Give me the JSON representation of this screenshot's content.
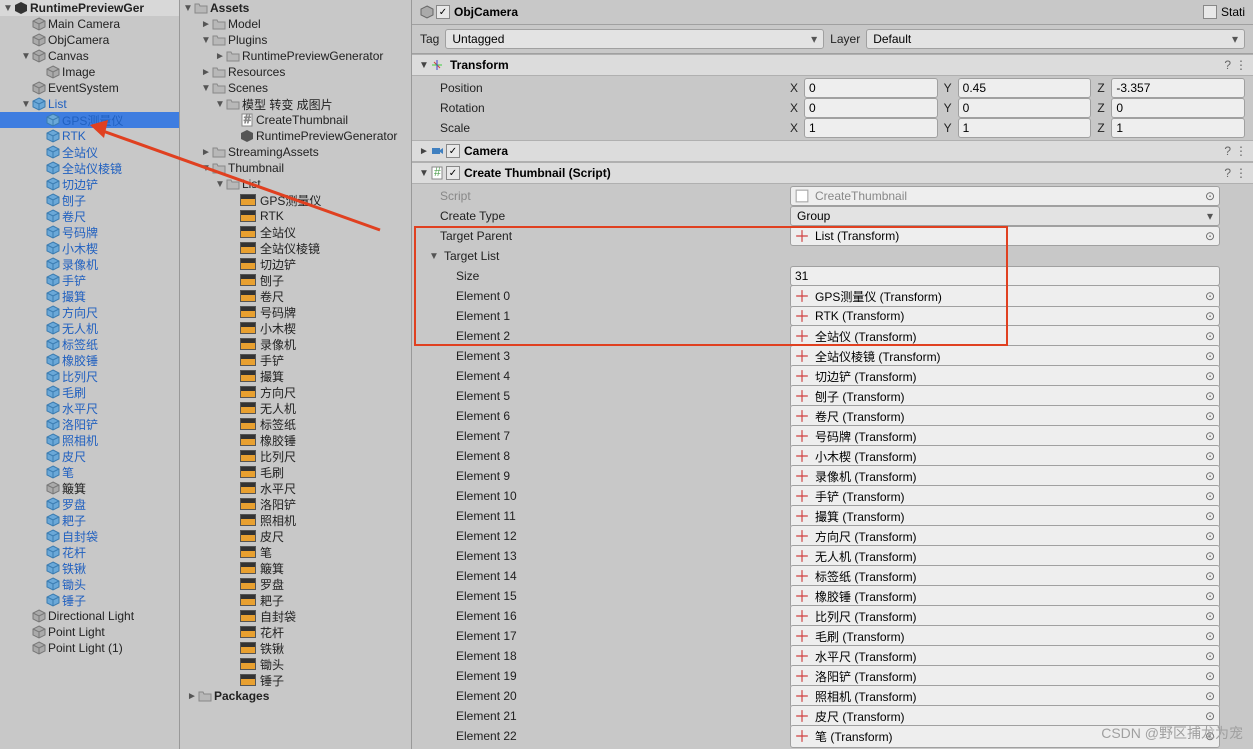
{
  "hierarchy": {
    "root": "RuntimePreviewGer",
    "items": [
      {
        "d": 1,
        "i": "cube-gray",
        "t": "Main Camera"
      },
      {
        "d": 1,
        "i": "cube-gray",
        "t": "ObjCamera"
      },
      {
        "d": 1,
        "i": "cube-gray",
        "t": "Canvas",
        "f": "open"
      },
      {
        "d": 2,
        "i": "cube-gray",
        "t": "Image"
      },
      {
        "d": 1,
        "i": "cube-gray",
        "t": "EventSystem"
      },
      {
        "d": 1,
        "i": "cube-blue",
        "t": "List",
        "f": "open",
        "blue": true
      },
      {
        "d": 2,
        "i": "cube-blue",
        "t": "GPS测量仪",
        "blue": true,
        "sel": true
      },
      {
        "d": 2,
        "i": "cube-blue",
        "t": "RTK",
        "blue": true
      },
      {
        "d": 2,
        "i": "cube-blue",
        "t": "全站仪",
        "blue": true
      },
      {
        "d": 2,
        "i": "cube-blue",
        "t": "全站仪棱镜",
        "blue": true
      },
      {
        "d": 2,
        "i": "cube-blue",
        "t": "切边铲",
        "blue": true
      },
      {
        "d": 2,
        "i": "cube-blue",
        "t": "刨子",
        "blue": true
      },
      {
        "d": 2,
        "i": "cube-blue",
        "t": "卷尺",
        "blue": true
      },
      {
        "d": 2,
        "i": "cube-blue",
        "t": "号码牌",
        "blue": true
      },
      {
        "d": 2,
        "i": "cube-blue",
        "t": "小木楔",
        "blue": true
      },
      {
        "d": 2,
        "i": "cube-blue",
        "t": "录像机",
        "blue": true
      },
      {
        "d": 2,
        "i": "cube-blue",
        "t": "手铲",
        "blue": true
      },
      {
        "d": 2,
        "i": "cube-blue",
        "t": "撮箕",
        "blue": true
      },
      {
        "d": 2,
        "i": "cube-blue",
        "t": "方向尺",
        "blue": true
      },
      {
        "d": 2,
        "i": "cube-blue",
        "t": "无人机",
        "blue": true
      },
      {
        "d": 2,
        "i": "cube-blue",
        "t": "标签纸",
        "blue": true
      },
      {
        "d": 2,
        "i": "cube-blue",
        "t": "橡胶锤",
        "blue": true
      },
      {
        "d": 2,
        "i": "cube-blue",
        "t": "比列尺",
        "blue": true
      },
      {
        "d": 2,
        "i": "cube-blue",
        "t": "毛刷",
        "blue": true
      },
      {
        "d": 2,
        "i": "cube-blue",
        "t": "水平尺",
        "blue": true
      },
      {
        "d": 2,
        "i": "cube-blue",
        "t": "洛阳铲",
        "blue": true
      },
      {
        "d": 2,
        "i": "cube-blue",
        "t": "照相机",
        "blue": true
      },
      {
        "d": 2,
        "i": "cube-blue",
        "t": "皮尺",
        "blue": true
      },
      {
        "d": 2,
        "i": "cube-blue",
        "t": "笔",
        "blue": true
      },
      {
        "d": 2,
        "i": "cube-gray",
        "t": "簸箕"
      },
      {
        "d": 2,
        "i": "cube-blue",
        "t": "罗盘",
        "blue": true
      },
      {
        "d": 2,
        "i": "cube-blue",
        "t": "耙子",
        "blue": true
      },
      {
        "d": 2,
        "i": "cube-blue",
        "t": "自封袋",
        "blue": true
      },
      {
        "d": 2,
        "i": "cube-blue",
        "t": "花杆",
        "blue": true
      },
      {
        "d": 2,
        "i": "cube-blue",
        "t": "铁锹",
        "blue": true
      },
      {
        "d": 2,
        "i": "cube-blue",
        "t": "锄头",
        "blue": true
      },
      {
        "d": 2,
        "i": "cube-blue",
        "t": "锤子",
        "blue": true
      },
      {
        "d": 1,
        "i": "cube-gray",
        "t": "Directional Light"
      },
      {
        "d": 1,
        "i": "cube-gray",
        "t": "Point Light"
      },
      {
        "d": 1,
        "i": "cube-gray",
        "t": "Point Light (1)"
      }
    ]
  },
  "project": {
    "root": "Assets",
    "items": [
      {
        "d": 1,
        "i": "folder",
        "t": "Model",
        "f": "closed"
      },
      {
        "d": 1,
        "i": "folder",
        "t": "Plugins",
        "f": "open"
      },
      {
        "d": 2,
        "i": "folder",
        "t": "RuntimePreviewGenerator",
        "f": "closed"
      },
      {
        "d": 1,
        "i": "folder",
        "t": "Resources",
        "f": "closed"
      },
      {
        "d": 1,
        "i": "folder",
        "t": "Scenes",
        "f": "open"
      },
      {
        "d": 2,
        "i": "folder",
        "t": "模型 转变 成图片",
        "f": "open"
      },
      {
        "d": 3,
        "i": "cs",
        "t": "CreateThumbnail"
      },
      {
        "d": 3,
        "i": "scene",
        "t": "RuntimePreviewGenerator"
      },
      {
        "d": 1,
        "i": "folder",
        "t": "StreamingAssets",
        "f": "closed"
      },
      {
        "d": 1,
        "i": "folder",
        "t": "Thumbnail",
        "f": "open"
      },
      {
        "d": 2,
        "i": "folder",
        "t": "List",
        "f": "open"
      },
      {
        "d": 3,
        "i": "asset",
        "t": "GPS测量仪"
      },
      {
        "d": 3,
        "i": "asset",
        "t": "RTK"
      },
      {
        "d": 3,
        "i": "asset",
        "t": "全站仪"
      },
      {
        "d": 3,
        "i": "asset",
        "t": "全站仪棱镜"
      },
      {
        "d": 3,
        "i": "asset",
        "t": "切边铲"
      },
      {
        "d": 3,
        "i": "asset",
        "t": "刨子"
      },
      {
        "d": 3,
        "i": "asset",
        "t": "卷尺"
      },
      {
        "d": 3,
        "i": "asset",
        "t": "号码牌"
      },
      {
        "d": 3,
        "i": "asset",
        "t": "小木楔"
      },
      {
        "d": 3,
        "i": "asset",
        "t": "录像机"
      },
      {
        "d": 3,
        "i": "asset",
        "t": "手铲"
      },
      {
        "d": 3,
        "i": "asset",
        "t": "撮箕"
      },
      {
        "d": 3,
        "i": "asset",
        "t": "方向尺"
      },
      {
        "d": 3,
        "i": "asset",
        "t": "无人机"
      },
      {
        "d": 3,
        "i": "asset",
        "t": "标签纸"
      },
      {
        "d": 3,
        "i": "asset",
        "t": "橡胶锤"
      },
      {
        "d": 3,
        "i": "asset",
        "t": "比列尺"
      },
      {
        "d": 3,
        "i": "asset",
        "t": "毛刷"
      },
      {
        "d": 3,
        "i": "asset",
        "t": "水平尺"
      },
      {
        "d": 3,
        "i": "asset",
        "t": "洛阳铲"
      },
      {
        "d": 3,
        "i": "asset",
        "t": "照相机"
      },
      {
        "d": 3,
        "i": "asset",
        "t": "皮尺"
      },
      {
        "d": 3,
        "i": "asset",
        "t": "笔"
      },
      {
        "d": 3,
        "i": "asset",
        "t": "簸箕"
      },
      {
        "d": 3,
        "i": "asset",
        "t": "罗盘"
      },
      {
        "d": 3,
        "i": "asset",
        "t": "耙子"
      },
      {
        "d": 3,
        "i": "asset",
        "t": "自封袋"
      },
      {
        "d": 3,
        "i": "asset",
        "t": "花杆"
      },
      {
        "d": 3,
        "i": "asset",
        "t": "铁锹"
      },
      {
        "d": 3,
        "i": "asset",
        "t": "锄头"
      },
      {
        "d": 3,
        "i": "asset",
        "t": "锤子"
      },
      {
        "d": 0,
        "i": "folder",
        "t": "Packages",
        "f": "closed",
        "bold": true
      }
    ]
  },
  "inspector": {
    "obj_name": "ObjCamera",
    "static_lbl": "Stati",
    "tag_lbl": "Tag",
    "tag_val": "Untagged",
    "layer_lbl": "Layer",
    "layer_val": "Default",
    "transform": {
      "title": "Transform",
      "position_lbl": "Position",
      "px": "0",
      "py": "0.45",
      "pz": "-3.357",
      "rotation_lbl": "Rotation",
      "rx": "0",
      "ry": "0",
      "rz": "0",
      "scale_lbl": "Scale",
      "sx": "1",
      "sy": "1",
      "sz": "1",
      "x": "X",
      "y": "Y",
      "z": "Z"
    },
    "camera": {
      "title": "Camera"
    },
    "script": {
      "title": "Create Thumbnail (Script)",
      "script_lbl": "Script",
      "script_val": "CreateThumbnail",
      "create_type_lbl": "Create Type",
      "create_type_val": "Group",
      "target_parent_lbl": "Target Parent",
      "target_parent_val": "List (Transform)",
      "target_list_lbl": "Target List",
      "size_lbl": "Size",
      "size_val": "31",
      "elements": [
        {
          "lbl": "Element 0",
          "val": "GPS测量仪 (Transform)"
        },
        {
          "lbl": "Element 1",
          "val": "RTK (Transform)"
        },
        {
          "lbl": "Element 2",
          "val": "全站仪 (Transform)"
        },
        {
          "lbl": "Element 3",
          "val": "全站仪棱镜 (Transform)"
        },
        {
          "lbl": "Element 4",
          "val": "切边铲 (Transform)"
        },
        {
          "lbl": "Element 5",
          "val": "刨子 (Transform)"
        },
        {
          "lbl": "Element 6",
          "val": "卷尺 (Transform)"
        },
        {
          "lbl": "Element 7",
          "val": "号码牌 (Transform)"
        },
        {
          "lbl": "Element 8",
          "val": "小木楔 (Transform)"
        },
        {
          "lbl": "Element 9",
          "val": "录像机 (Transform)"
        },
        {
          "lbl": "Element 10",
          "val": "手铲 (Transform)"
        },
        {
          "lbl": "Element 11",
          "val": "撮箕 (Transform)"
        },
        {
          "lbl": "Element 12",
          "val": "方向尺 (Transform)"
        },
        {
          "lbl": "Element 13",
          "val": "无人机 (Transform)"
        },
        {
          "lbl": "Element 14",
          "val": "标签纸 (Transform)"
        },
        {
          "lbl": "Element 15",
          "val": "橡胶锤 (Transform)"
        },
        {
          "lbl": "Element 16",
          "val": "比列尺 (Transform)"
        },
        {
          "lbl": "Element 17",
          "val": "毛刷 (Transform)"
        },
        {
          "lbl": "Element 18",
          "val": "水平尺 (Transform)"
        },
        {
          "lbl": "Element 19",
          "val": "洛阳铲 (Transform)"
        },
        {
          "lbl": "Element 20",
          "val": "照相机 (Transform)"
        },
        {
          "lbl": "Element 21",
          "val": "皮尺 (Transform)"
        },
        {
          "lbl": "Element 22",
          "val": "笔 (Transform)"
        }
      ]
    }
  },
  "watermark": "CSDN @野区捕龙为宠"
}
